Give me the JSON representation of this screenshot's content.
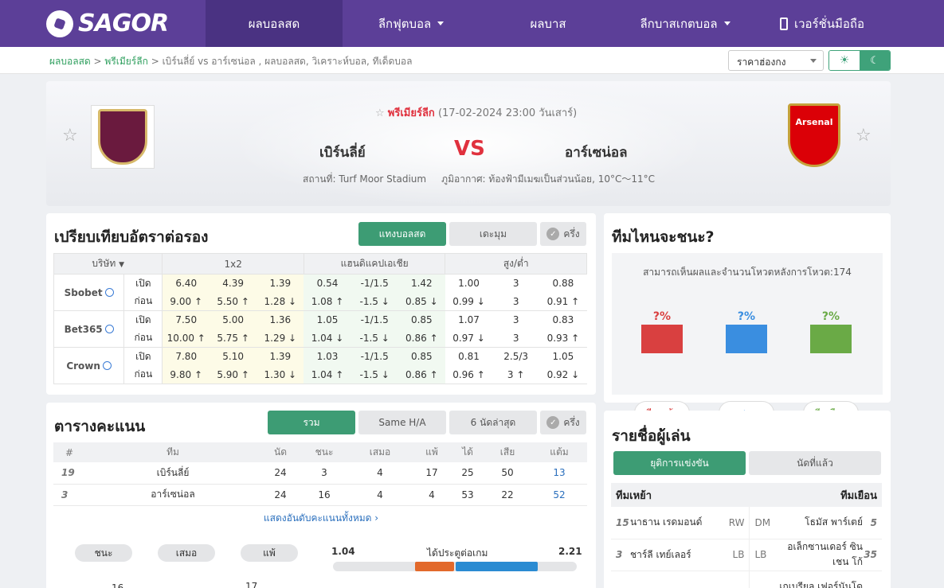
{
  "nav": {
    "logo": "SAGOR",
    "items": [
      "ผลบอลสด",
      "ลีกฟุตบอล",
      "ผลบาส",
      "ลีกบาสเกตบอล",
      "เวอร์ชั่นมือถือ"
    ]
  },
  "breadcrumb": {
    "home": "ผลบอลสด",
    "sep1": ">",
    "league": "พรีเมียร์ลีก",
    "rest": "> เบิร์นลี่ย์ vs  อาร์เซน่อล ,  ผลบอลสด,  วิเคราะห์บอล,  ทีเด็ดบอล"
  },
  "odds_select": "ราคาฮ่องกง",
  "match": {
    "league": "พรีเมียร์ลีก",
    "datetime": "(17-02-2024 23:00 วันเสาร์)",
    "home": "เบิร์นลี่ย์",
    "away": "อาร์เซน่อล",
    "vs": "VS",
    "away_crest_text": "Arsenal",
    "venue": "สถานที่: Turf Moor Stadium",
    "weather": "ภูมิอากาศ: ท้องฟ้ามีเมฆเป็นส่วนน้อย, 10°C～11°C"
  },
  "odds": {
    "title": "เปรียบเทียบอัตราต่อรอง",
    "tab_active": "แทงบอลสด",
    "tab_other": "เดะมุม",
    "half": "ครึ่ง",
    "headers": [
      "บริษัท",
      "1x2",
      "แฮนดิแคปเอเชีย",
      "สูง/ต่ำ"
    ],
    "open": "เปิด",
    "before": "ก่อน",
    "books": [
      {
        "name": "Sbobet",
        "open": [
          "6.40",
          "4.39",
          "1.39",
          "0.54",
          "-1/1.5",
          "1.42",
          "1.00",
          "3",
          "0.88"
        ],
        "before": [
          "9.00",
          "5.50",
          "1.28",
          "1.08",
          "-1.5",
          "0.85",
          "0.99",
          "3",
          "0.91"
        ],
        "dir": [
          "up",
          "up",
          "dn",
          "up",
          "dn",
          "dn",
          "dn",
          "",
          "up"
        ]
      },
      {
        "name": "Bet365",
        "open": [
          "7.50",
          "5.00",
          "1.36",
          "1.05",
          "-1/1.5",
          "0.85",
          "1.07",
          "3",
          "0.83"
        ],
        "before": [
          "10.00",
          "5.75",
          "1.29",
          "1.04",
          "-1.5",
          "0.86",
          "0.97",
          "3",
          "0.93"
        ],
        "dir": [
          "up",
          "up",
          "dn",
          "dn",
          "dn",
          "up",
          "dn",
          "",
          "up"
        ]
      },
      {
        "name": "Crown",
        "open": [
          "7.80",
          "5.10",
          "1.39",
          "1.03",
          "-1/1.5",
          "0.85",
          "0.81",
          "2.5/3",
          "1.05"
        ],
        "before": [
          "9.80",
          "5.90",
          "1.30",
          "1.04",
          "-1.5",
          "0.86",
          "0.96",
          "3",
          "0.92"
        ],
        "dir": [
          "up",
          "up",
          "dn",
          "up",
          "dn",
          "up",
          "up",
          "up",
          "dn"
        ]
      }
    ]
  },
  "standings": {
    "title": "ตารางคะแนน",
    "tabs": [
      "รวม",
      "Same H/A",
      "6 นัดล่าสุด"
    ],
    "half": "ครึ่ง",
    "headers": [
      "#",
      "ทีม",
      "นัด",
      "ชนะ",
      "เสมอ",
      "แพ้",
      "ได้",
      "เสีย",
      "แต้ม"
    ],
    "rows": [
      [
        "19",
        "เบิร์นลี่ย์",
        "24",
        "3",
        "4",
        "17",
        "25",
        "50",
        "13"
      ],
      [
        "3",
        "อาร์เซน่อล",
        "24",
        "16",
        "4",
        "4",
        "53",
        "22",
        "52"
      ]
    ],
    "show_all": "แสดงอันดับคะแนนทั้งหมด",
    "pills": [
      "ชนะ",
      "เสมอ",
      "แพ้"
    ],
    "goals_label": "ได้ประตูต่อเกม",
    "goals_home": "1.04",
    "goals_away": "2.21",
    "bottom_home": "16",
    "bottom_away": "17"
  },
  "prediction": {
    "title": "ทีมไหนจะชนะ?",
    "subtitle": "สามารถเห็นผลและจำนวนโหวตหลังการโหวต:174",
    "items": [
      {
        "pct": "?%",
        "label": "ทีมเหย้า",
        "color": "#d94040"
      },
      {
        "pct": "?%",
        "label": "เสมอ",
        "color": "#3a8ee0"
      },
      {
        "pct": "?%",
        "label": "ทีมเยือน",
        "color": "#6aaa46"
      }
    ]
  },
  "players": {
    "title": "รายชื่อผู้เล่น",
    "tabs": [
      "ยุติการแข่งขัน",
      "นัดที่แล้ว"
    ],
    "home_label": "ทีมเหย้า",
    "away_label": "ทีมเยือน",
    "rows": [
      {
        "hn": "15",
        "hname": "นาธาน เรดมอนด์",
        "hpos": "RW",
        "apos": "DM",
        "aname": "โธมัส พาร์เตย์",
        "an": "5"
      },
      {
        "hn": "3",
        "hname": "ชาร์ลี เทย์เลอร์",
        "hpos": "LB",
        "apos": "LB",
        "aname": "อเล็กซานเดอร์ ซินเชน โก้",
        "an": "35"
      },
      {
        "hn": "",
        "hname": "",
        "hpos": "",
        "apos": "",
        "aname": "เกเบรียล เฟอร์นันโด",
        "an": ""
      }
    ]
  }
}
